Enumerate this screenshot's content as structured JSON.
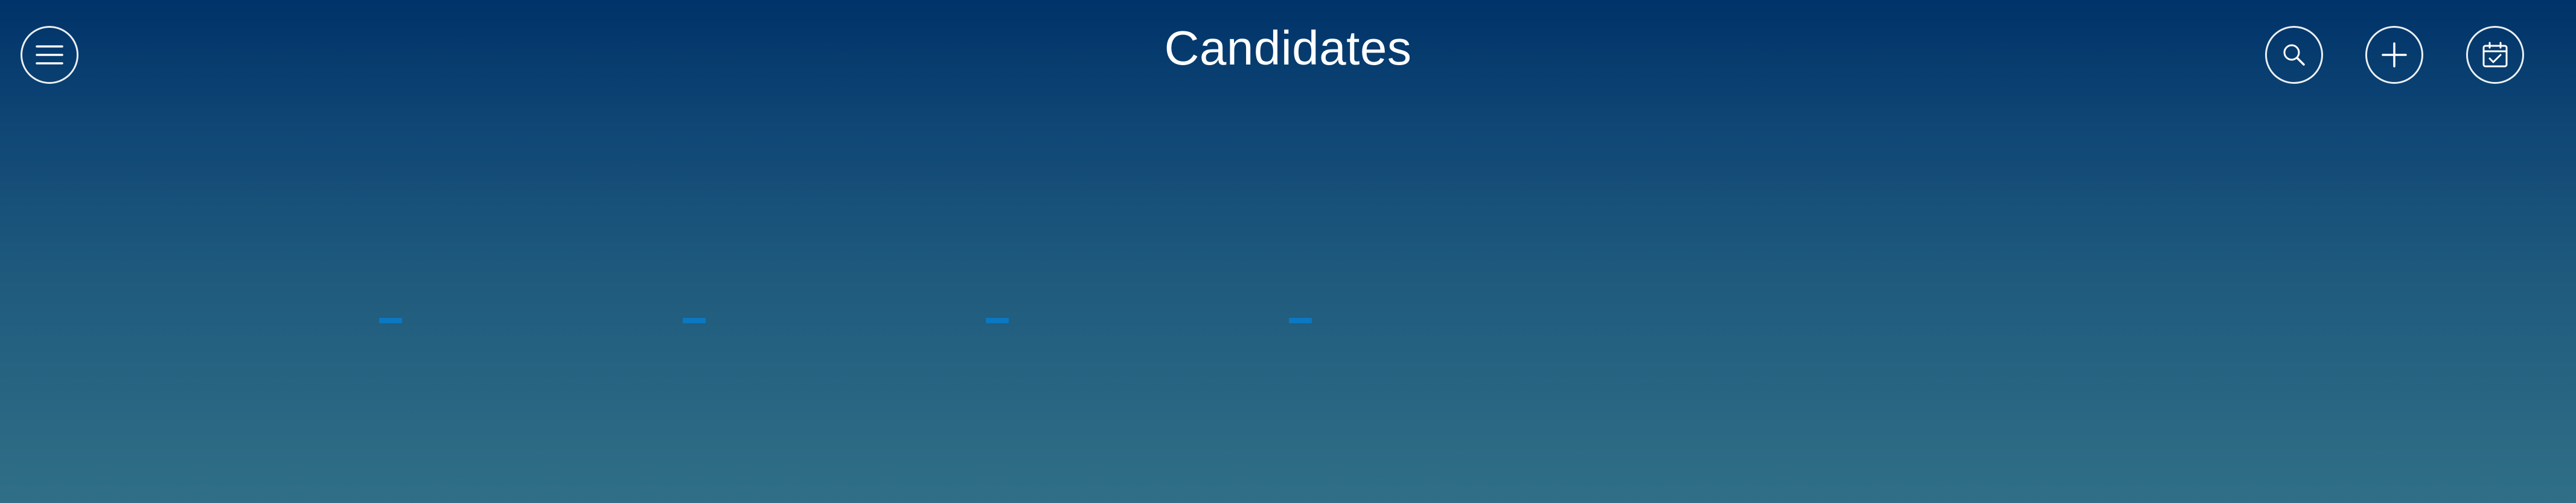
{
  "header": {
    "title": "Candidates",
    "menu_icon": "hamburger-menu-icon",
    "search_icon": "search-icon",
    "add_icon": "plus-icon",
    "calendar_icon": "calendar-check-icon"
  },
  "loading_indicator": {
    "dash_count": 4,
    "color": "#0a78c2"
  },
  "colors": {
    "background_top": "#003369",
    "background_bottom": "#306f87",
    "icon_stroke": "#ffffff"
  }
}
